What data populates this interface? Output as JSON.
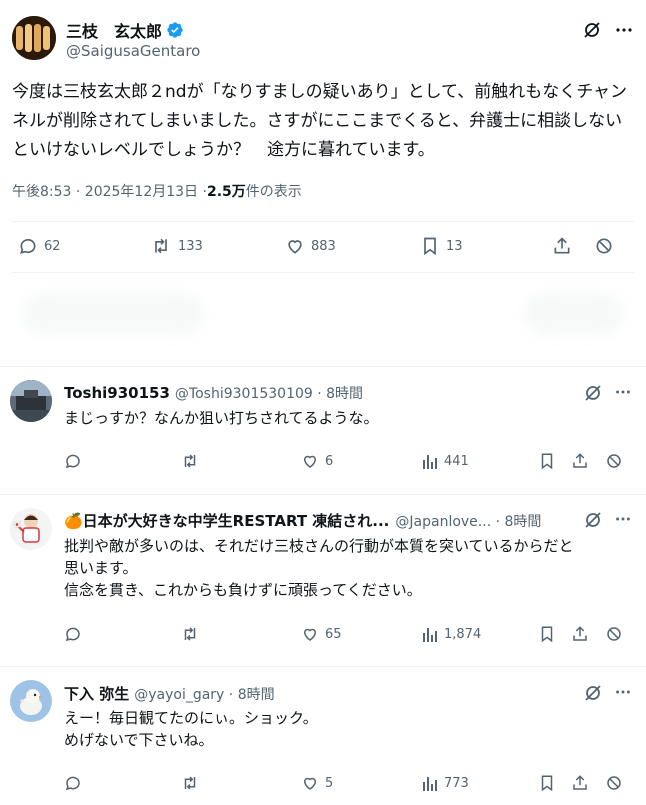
{
  "main_tweet": {
    "author_name": "三枝　玄太郎",
    "author_handle": "@SaigusaGentaro",
    "verified": true,
    "text": "今度は三枝玄太郎２ndが「なりすましの疑いあり」として、前触れもなくチャンネルが削除されてしまいました。さすがにここまでくると、弁護士に相談しないといけないレベルでしょうか？　途方に暮れています。",
    "time": "午後8:53 · 2025年12月13日 · ",
    "views_count": "2.5万",
    "views_label": " 件の表示",
    "replies": "62",
    "retweets": "133",
    "likes": "883",
    "bookmarks": "13"
  },
  "replies": [
    {
      "author_name": "Toshi930153",
      "author_handle": "@Toshi9301530109 · 8時間",
      "text_lines": [
        "まじっすか？なんか狙い打ちされてるような。"
      ],
      "likes": "6",
      "views": "441"
    },
    {
      "author_name": "🍊日本が大好きな中学生RESTART 凍結され...",
      "author_handle": "@Japanlove... · 8時間",
      "text_lines": [
        "批判や敵が多いのは、それだけ三枝さんの行動が本質を突いているからだと",
        "思います。",
        "信念を貫き、これからも負けずに頑張ってください。"
      ],
      "likes": "65",
      "views": "1,874"
    },
    {
      "author_name": "下入 弥生",
      "author_handle": "@yayoi_gary · 8時間",
      "text_lines": [
        "えー！毎日観てたのにぃ。ショック。",
        "めげないで下さいね。"
      ],
      "likes": "5",
      "views": "773"
    }
  ],
  "colors": {
    "verified": "#1d9bf0",
    "text": "#0f1419",
    "muted": "#536471",
    "divider": "#eff3f4"
  },
  "icons": [
    "grok-icon",
    "more-icon",
    "reply-icon",
    "retweet-icon",
    "like-icon",
    "bookmark-icon",
    "share-icon",
    "block-icon",
    "views-icon",
    "verified-badge-icon"
  ]
}
